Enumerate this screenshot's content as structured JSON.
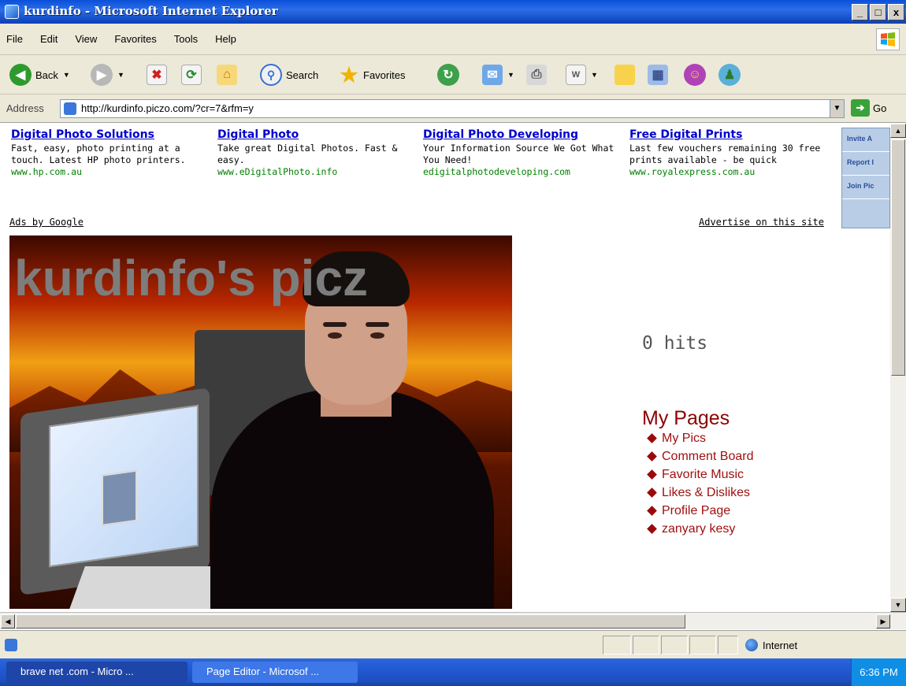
{
  "window": {
    "title": "kurdinfo - Microsoft Internet Explorer",
    "controls": [
      "_",
      "□",
      "x"
    ]
  },
  "menu": [
    "File",
    "Edit",
    "View",
    "Favorites",
    "Tools",
    "Help"
  ],
  "toolbar": {
    "back": "Back",
    "search": "Search",
    "favorites": "Favorites"
  },
  "address": {
    "label": "Address",
    "url": "http://kurdinfo.piczo.com/?cr=7&rfm=y",
    "go": "Go"
  },
  "ads": [
    {
      "title": "Digital Photo Solutions",
      "desc": "Fast, easy, photo printing at a touch. Latest HP photo printers.",
      "url": "www.hp.com.au"
    },
    {
      "title": "Digital Photo",
      "desc": "Take great Digital Photos. Fast & easy.",
      "url": "www.eDigitalPhoto.info"
    },
    {
      "title": "Digital Photo Developing",
      "desc": "Your Information Source We Got What You Need!",
      "url": "edigitalphotodeveloping.com"
    },
    {
      "title": "Free Digital Prints",
      "desc": "Last few vouchers remaining 30 free prints available - be quick",
      "url": "www.royalexpress.com.au"
    }
  ],
  "ads_by": "Ads by Google",
  "advertise": "Advertise on this site",
  "side_panel": [
    "Invite A",
    "Report I",
    "Join Pic"
  ],
  "headline": "kurdinfo's picz",
  "hits": "0 hits",
  "my_pages": {
    "heading": "My Pages",
    "items": [
      "My Pics",
      "Comment Board",
      "Favorite Music",
      "Likes & Dislikes",
      "Profile Page",
      "zanyary kesy"
    ]
  },
  "status": {
    "zone": "Internet"
  },
  "taskbar": {
    "tasks": [
      "brave net .com - Micro ...",
      "Page Editor - Microsof ..."
    ],
    "clock": "6:36 PM"
  }
}
